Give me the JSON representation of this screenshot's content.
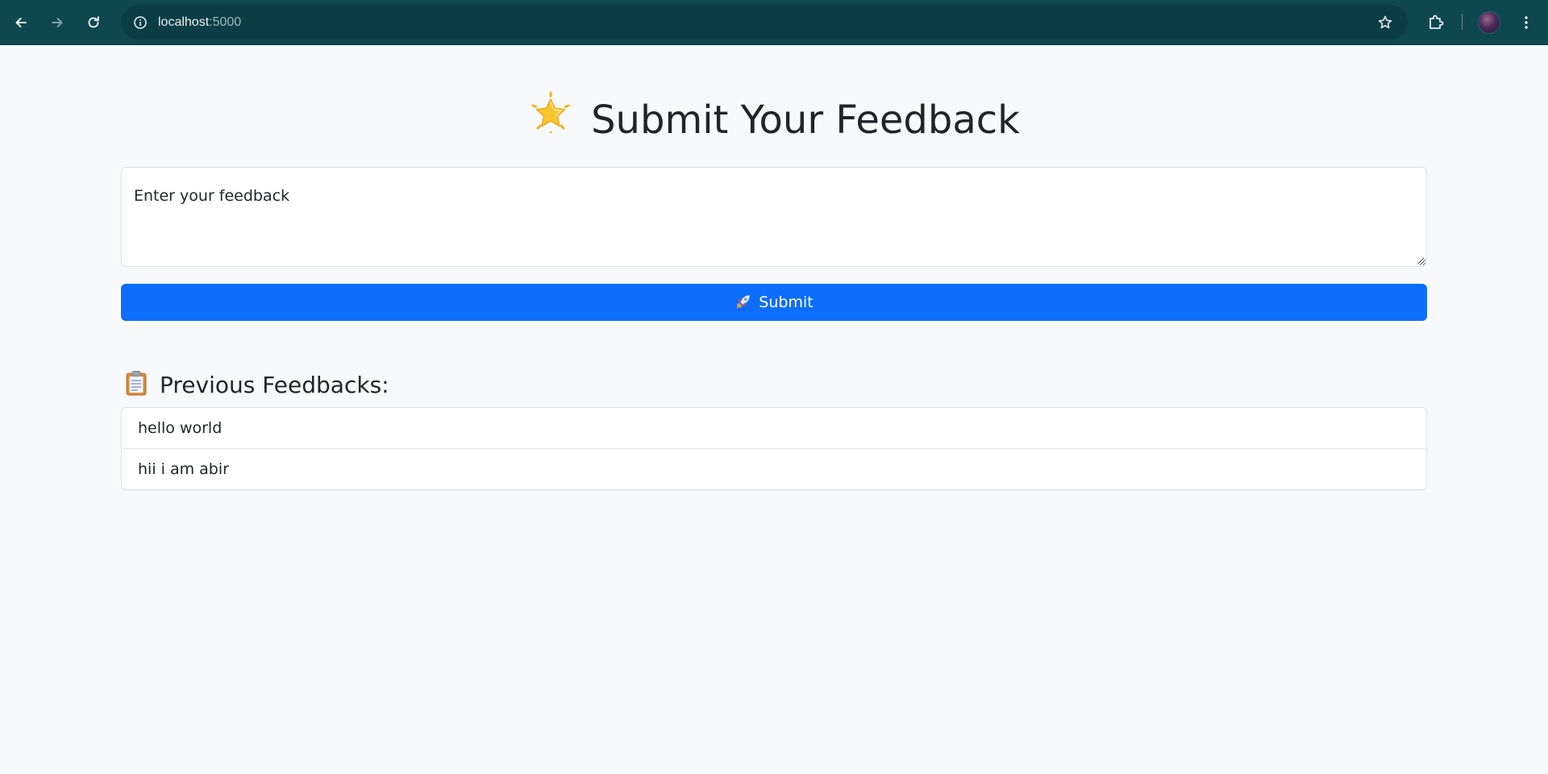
{
  "browser": {
    "url_host": "localhost",
    "url_port": ":5000",
    "icons": {
      "back": "arrow-left-icon",
      "forward": "arrow-right-icon",
      "reload": "reload-icon",
      "site_info": "info-icon",
      "bookmark": "star-outline-icon",
      "extensions": "puzzle-icon",
      "menu": "kebab-menu-icon"
    },
    "colors": {
      "toolbar_bg": "#0f474f",
      "omnibox_bg": "#0b3d44"
    }
  },
  "main": {
    "title": "Submit Your Feedback",
    "title_icon": "glowing-star-emoji",
    "feedback_placeholder": "Enter your feedback",
    "submit_label": "Submit",
    "submit_icon": "rocket-emoji",
    "previous_heading": "Previous Feedbacks:",
    "previous_icon": "clipboard-emoji",
    "feedbacks": [
      "hello world",
      "hii i am abir"
    ],
    "colors": {
      "primary": "#0d6efd",
      "page_bg": "#f8f9fa",
      "border": "#dee2e6",
      "text": "#212529"
    }
  }
}
